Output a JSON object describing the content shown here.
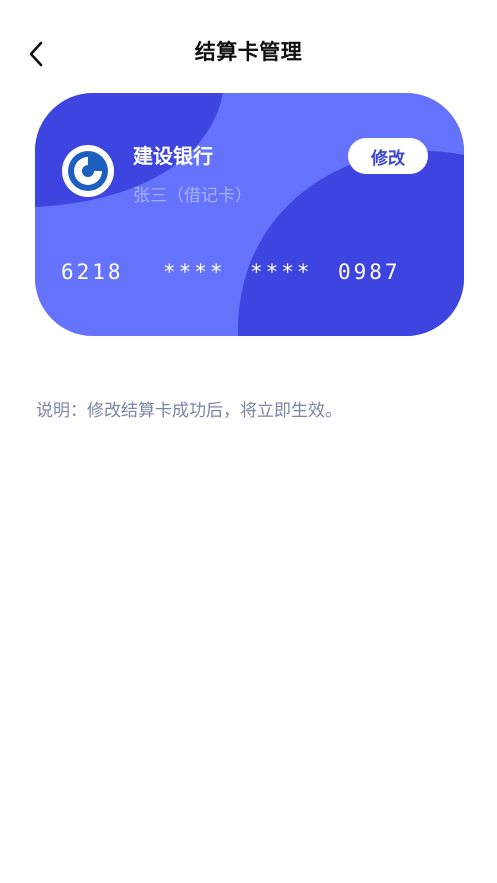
{
  "header": {
    "title": "结算卡管理",
    "back_icon": "chevron-left-icon"
  },
  "card": {
    "bank_name": "建设银行",
    "holder_info": "张三（借记卡）",
    "edit_label": "修改",
    "logo_icon": "ccb-bank-logo",
    "number_segments": [
      "6218",
      "****",
      "****",
      "0987"
    ],
    "colors": {
      "base": "#6572FB",
      "dark": "#3D44E0",
      "accent": "#3B45D8"
    }
  },
  "note": "说明：修改结算卡成功后，将立即生效。"
}
